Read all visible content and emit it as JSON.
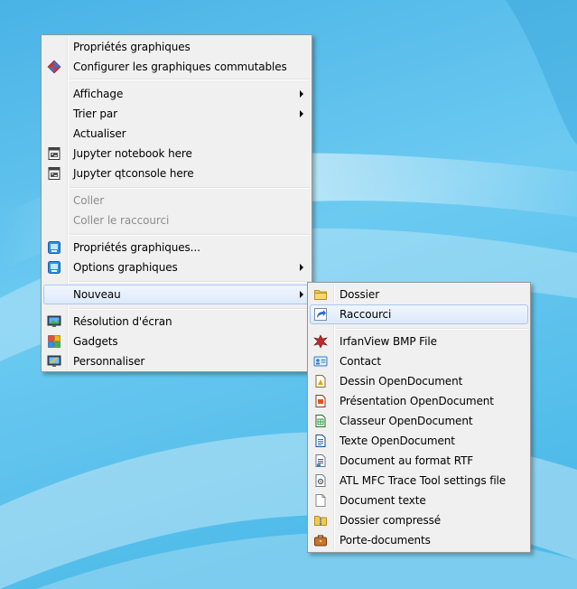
{
  "colors": {
    "desktop_blue": "#5fc1ec",
    "menu_background": "#f0f0f0",
    "highlight_border": "#a8c7ee",
    "disabled_text": "#8d8d8d"
  },
  "context_menu": {
    "items": [
      {
        "label": "Propriétés graphiques",
        "icon": "none"
      },
      {
        "label": "Configurer les graphiques commutables",
        "icon": "switchable-graphics-icon"
      },
      {
        "label": "Affichage",
        "icon": "none",
        "submenu": true
      },
      {
        "label": "Trier par",
        "icon": "none",
        "submenu": true
      },
      {
        "label": "Actualiser",
        "icon": "none"
      },
      {
        "label": "Jupyter notebook here",
        "icon": "jupyter-notebook-icon"
      },
      {
        "label": "Jupyter qtconsole here",
        "icon": "jupyter-qtconsole-icon"
      },
      {
        "label": "Coller",
        "icon": "none",
        "disabled": true
      },
      {
        "label": "Coller le raccourci",
        "icon": "none",
        "disabled": true
      },
      {
        "label": "Propriétés graphiques...",
        "icon": "intel-graphics-icon"
      },
      {
        "label": "Options graphiques",
        "icon": "intel-graphics-options-icon",
        "submenu": true
      },
      {
        "label": "Nouveau",
        "icon": "none",
        "submenu": true,
        "highlighted": true
      },
      {
        "label": "Résolution d'écran",
        "icon": "screen-resolution-icon"
      },
      {
        "label": "Gadgets",
        "icon": "gadgets-icon"
      },
      {
        "label": "Personnaliser",
        "icon": "personalize-icon"
      }
    ]
  },
  "new_submenu": {
    "items": [
      {
        "label": "Dossier",
        "icon": "folder-icon"
      },
      {
        "label": "Raccourci",
        "icon": "shortcut-icon",
        "highlighted": true
      },
      {
        "label": "IrfanView BMP File",
        "icon": "irfanview-icon"
      },
      {
        "label": "Contact",
        "icon": "contact-icon"
      },
      {
        "label": "Dessin OpenDocument",
        "icon": "odg-icon"
      },
      {
        "label": "Présentation OpenDocument",
        "icon": "odp-icon"
      },
      {
        "label": "Classeur OpenDocument",
        "icon": "ods-icon"
      },
      {
        "label": "Texte OpenDocument",
        "icon": "odt-icon"
      },
      {
        "label": "Document au format RTF",
        "icon": "rtf-icon"
      },
      {
        "label": "ATL MFC Trace Tool settings file",
        "icon": "trace-tool-icon"
      },
      {
        "label": "Document texte",
        "icon": "text-document-icon"
      },
      {
        "label": "Dossier compressé",
        "icon": "zip-folder-icon"
      },
      {
        "label": "Porte-documents",
        "icon": "briefcase-icon"
      }
    ]
  }
}
